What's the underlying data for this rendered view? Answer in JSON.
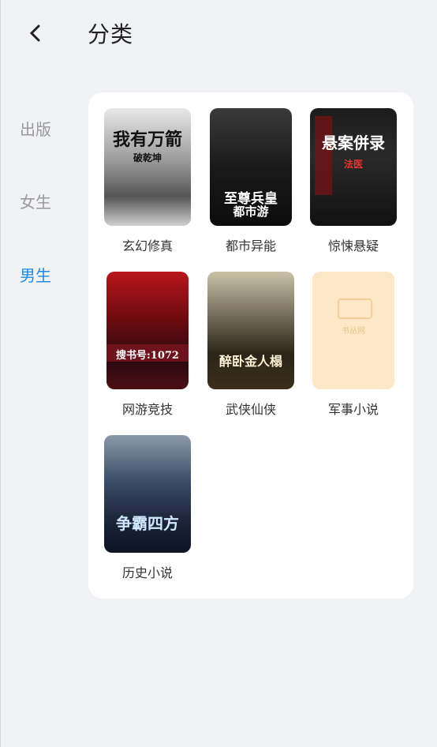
{
  "header": {
    "title": "分类"
  },
  "sidebar": {
    "items": [
      {
        "label": "出版"
      },
      {
        "label": "女生"
      },
      {
        "label": "男生"
      }
    ]
  },
  "categories": [
    {
      "label": "玄幻修真",
      "cover_title": "我有万箭",
      "cover_sub": "破乾坤"
    },
    {
      "label": "都市异能",
      "cover_title": "至尊兵皇",
      "cover_sub": "都市游"
    },
    {
      "label": "惊悚悬疑",
      "cover_title": "悬案併录",
      "cover_sub": "法医"
    },
    {
      "label": "网游竞技",
      "cover_title": "搜书号:1072",
      "cover_sub": ""
    },
    {
      "label": "武侠仙侠",
      "cover_title": "醉卧金人榻",
      "cover_sub": ""
    },
    {
      "label": "军事小说",
      "cover_title": "书丛网",
      "cover_sub": ""
    },
    {
      "label": "历史小说",
      "cover_title": "争霸四方",
      "cover_sub": ""
    }
  ]
}
